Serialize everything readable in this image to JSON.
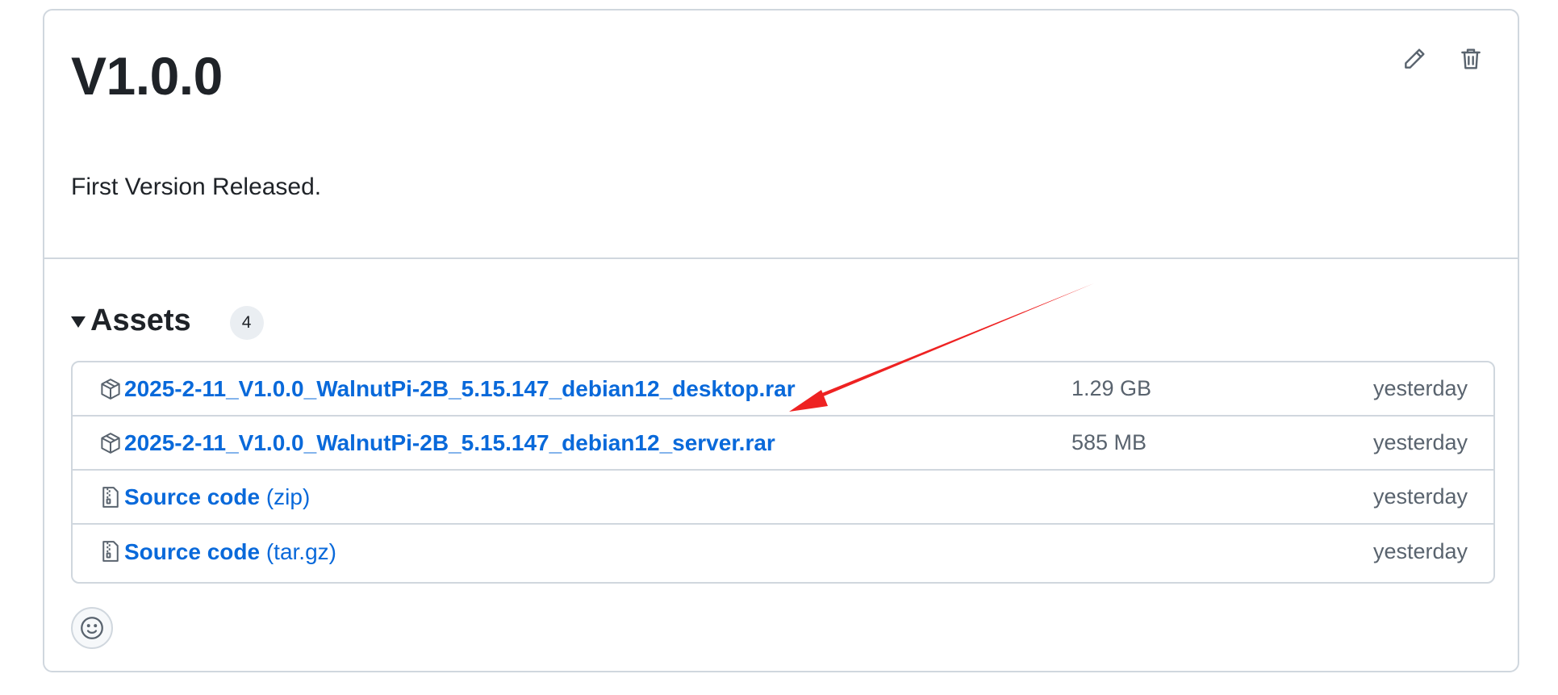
{
  "release": {
    "title": "V1.0.0",
    "body": "First Version Released."
  },
  "icons": {
    "edit": "pencil-icon",
    "delete": "trash-icon",
    "package": "package-icon",
    "zip": "file-zip-icon",
    "reaction": "smiley-icon"
  },
  "assets": {
    "label": "Assets",
    "count": "4",
    "items": [
      {
        "icon": "package-icon",
        "name": "2025-2-11_V1.0.0_WalnutPi-2B_5.15.147_debian12_desktop.rar",
        "size": "1.29 GB",
        "date": "yesterday"
      },
      {
        "icon": "package-icon",
        "name": "2025-2-11_V1.0.0_WalnutPi-2B_5.15.147_debian12_server.rar",
        "size": "585 MB",
        "date": "yesterday"
      },
      {
        "icon": "file-zip-icon",
        "name": "Source code",
        "format": "(zip)",
        "date": "yesterday"
      },
      {
        "icon": "file-zip-icon",
        "name": "Source code",
        "format": "(tar.gz)",
        "date": "yesterday"
      }
    ]
  },
  "colors": {
    "link": "#0969da",
    "muted": "#59636e",
    "border": "#d0d7de",
    "annotation_arrow": "#ee2222"
  }
}
